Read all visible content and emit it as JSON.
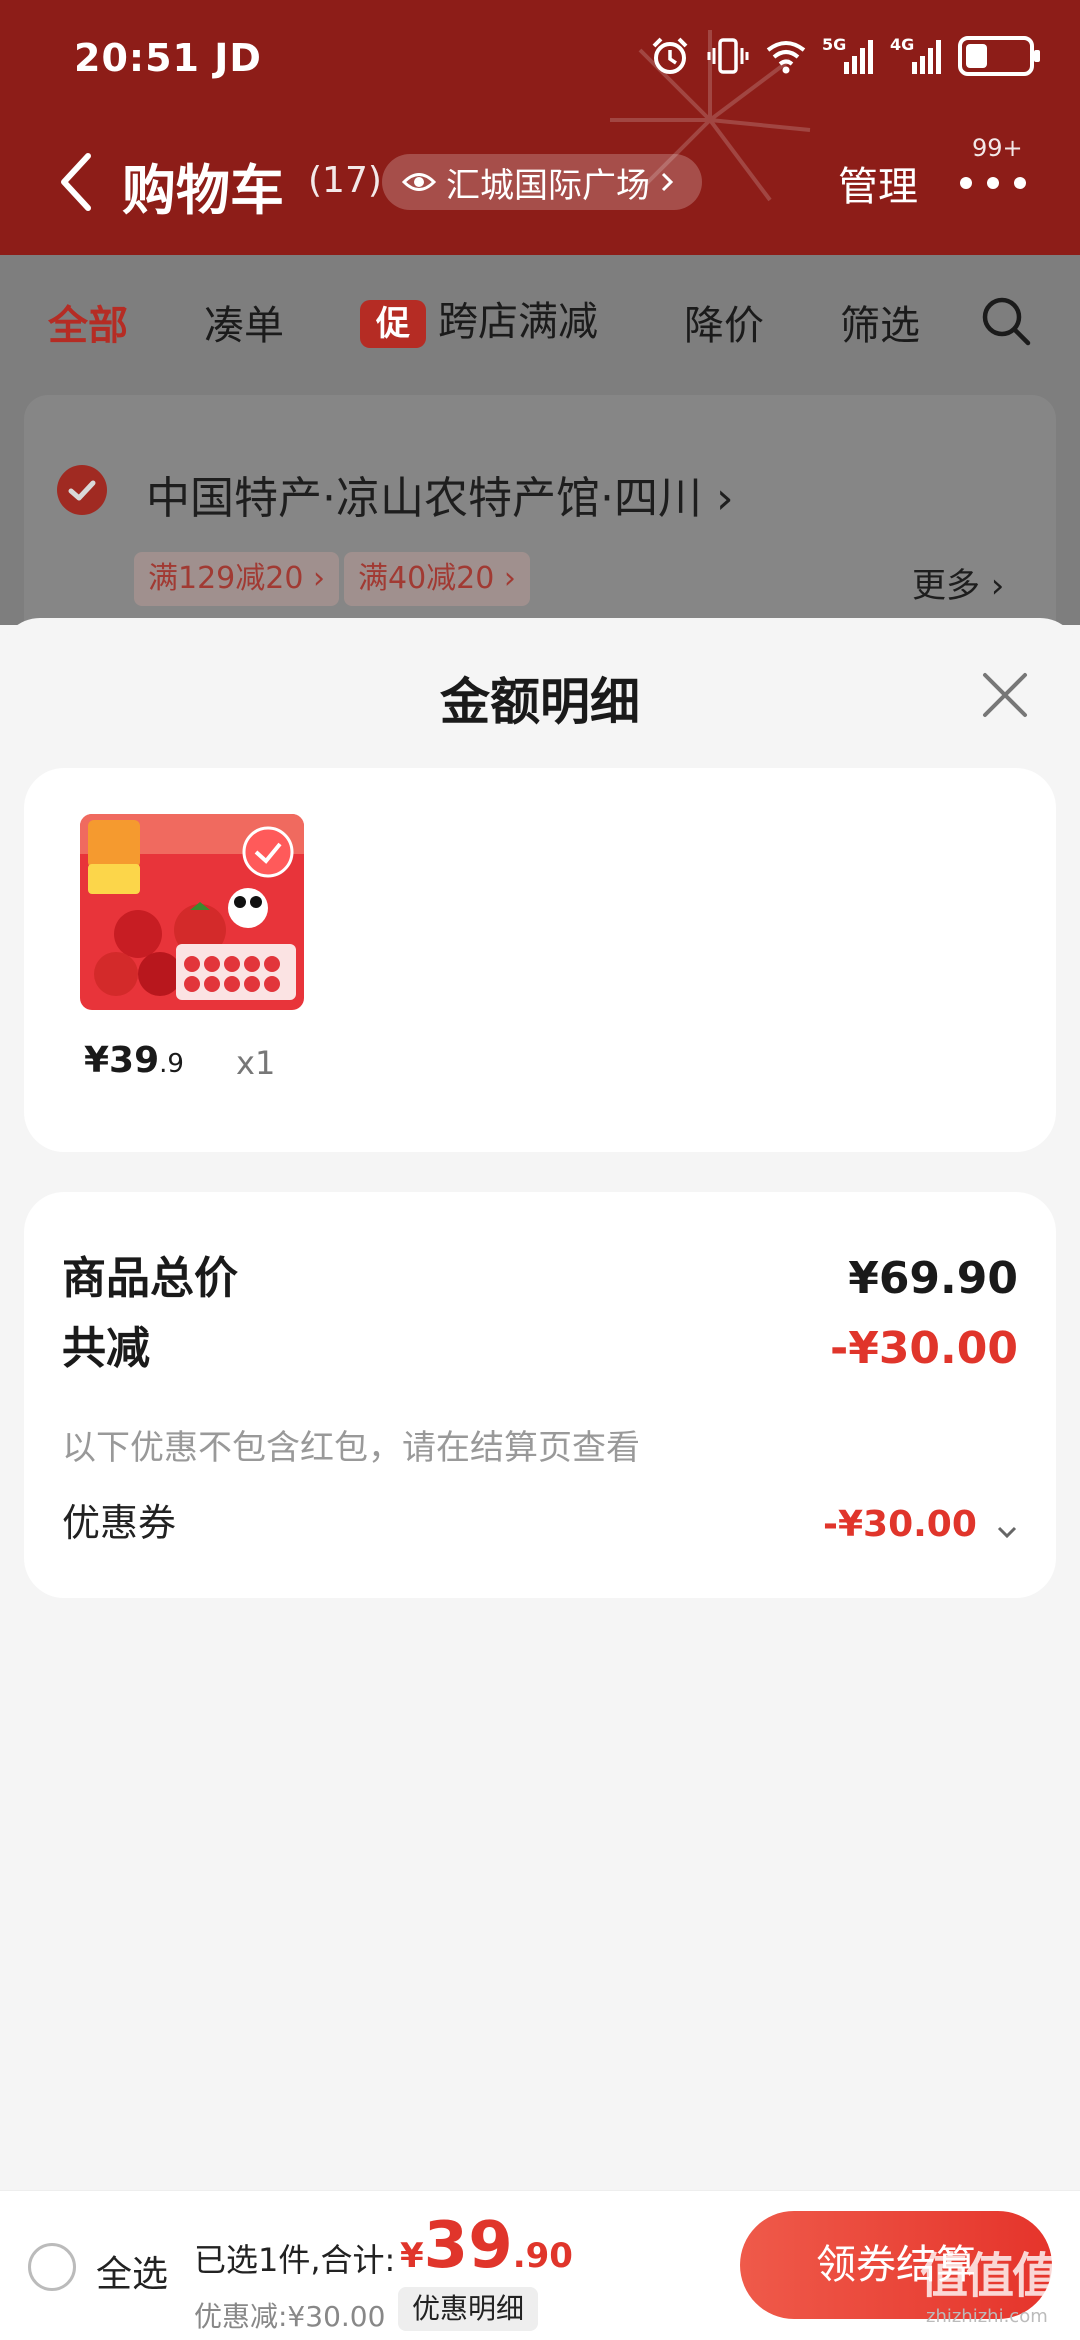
{
  "status_bar": {
    "time": "20:51 JD",
    "icons": [
      "alarm-icon",
      "vibrate-icon",
      "wifi-icon",
      "5g-signal-icon",
      "4g-signal-icon",
      "battery-icon"
    ],
    "battery_level": 0.35
  },
  "header": {
    "title": "购物车",
    "count": "(17)",
    "location": "汇城国际广场",
    "manage": "管理",
    "badge": "99+"
  },
  "tabs": [
    {
      "label": "全部",
      "active": true
    },
    {
      "label": "凑单"
    },
    {
      "label": "跨店满减",
      "tag": "促"
    },
    {
      "label": "降价"
    },
    {
      "label": "筛选"
    }
  ],
  "shop": {
    "name": "中国特产·凉山农特产馆·四川",
    "coupons": [
      "满129减20",
      "满40减20"
    ],
    "more": "更多"
  },
  "sheet": {
    "title": "金额明细",
    "product": {
      "price_int": "¥39",
      "price_dec": ".9",
      "qty": "x1"
    },
    "summary": {
      "total_label": "商品总价",
      "total_value": "¥69.90",
      "reduce_label": "共减",
      "reduce_value": "-¥30.00",
      "note": "以下优惠不包含红包，请在结算页查看",
      "coupon_label": "优惠券",
      "coupon_value": "-¥30.00"
    }
  },
  "bottom": {
    "select_all": "全选",
    "selected_info": "已选1件,合计:",
    "total_yen": "¥",
    "total_int": "39",
    "total_dec": ".90",
    "discount": "优惠减:¥30.00",
    "detail_button": "优惠明细",
    "checkout": "领券结算"
  },
  "watermark": {
    "text": "值值值",
    "sub": "zhizhizhi.com"
  },
  "colors": {
    "header_red": "#8d1d18",
    "accent_red": "#e0352b",
    "tab_red": "#b52c24"
  }
}
